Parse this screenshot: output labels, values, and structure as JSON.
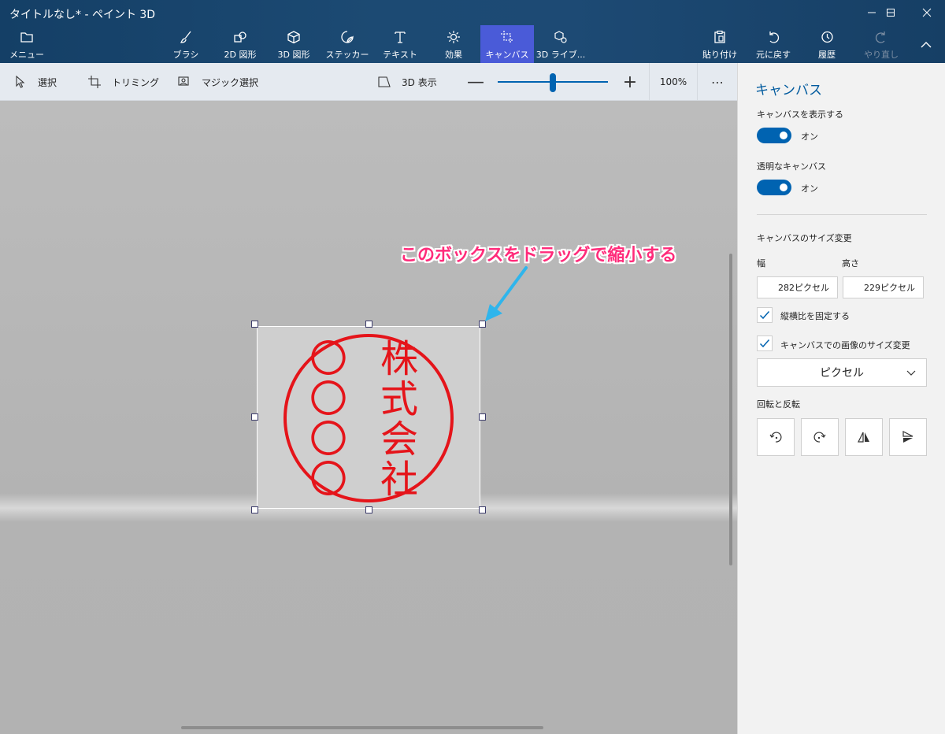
{
  "window": {
    "title": "タイトルなし* - ペイント 3D"
  },
  "ribbon": {
    "menu_label": "メニュー",
    "tools": [
      {
        "label": "ブラシ"
      },
      {
        "label": "2D 図形"
      },
      {
        "label": "3D 図形"
      },
      {
        "label": "ステッカー"
      },
      {
        "label": "テキスト"
      },
      {
        "label": "効果"
      },
      {
        "label": "キャンバス"
      },
      {
        "label": "3D ライブ..."
      }
    ],
    "actions": [
      {
        "label": "貼り付け"
      },
      {
        "label": "元に戻す"
      },
      {
        "label": "履歴"
      },
      {
        "label": "やり直し"
      }
    ],
    "accent": "#4a5bd8"
  },
  "subtoolbar": {
    "select_label": "選択",
    "trim_label": "トリミング",
    "magic_label": "マジック選択",
    "view3d_label": "3D 表示",
    "zoom_minus": "—",
    "zoom_plus": "+",
    "zoom_value": "100%",
    "zoom_fraction": 0.5,
    "more": "⋯"
  },
  "canvas": {
    "annotation": "このボックスをドラッグで縮小する",
    "stamp_left": "〇〇〇〇",
    "stamp_right": "株式会社",
    "stamp_color": "#e5141a",
    "annotation_color": "#ff2b7a"
  },
  "panel": {
    "title": "キャンバス",
    "show_canvas_label": "キャンバスを表示する",
    "show_canvas_state": "オン",
    "transparent_label": "透明なキャンバス",
    "transparent_state": "オン",
    "resize_label": "キャンバスのサイズ変更",
    "width_label": "幅",
    "height_label": "高さ",
    "width_value": "282ピクセル",
    "height_value": "229ピクセル",
    "lock_ratio_label": "縦横比を固定する",
    "resize_image_label": "キャンバスでの画像のサイズ変更",
    "unit_value": "ピクセル",
    "rotate_label": "回転と反転"
  }
}
